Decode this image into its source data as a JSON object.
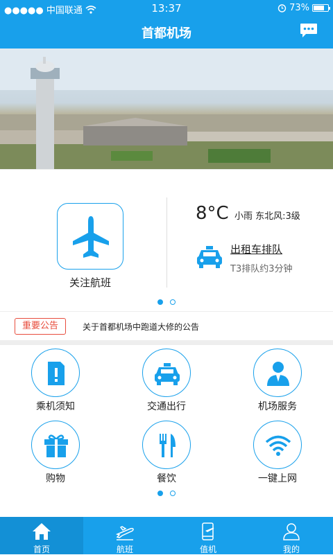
{
  "status_bar": {
    "carrier": "●●●●● 中国联通",
    "time": "13:37",
    "battery": "73%",
    "battery_level": 0.73
  },
  "nav": {
    "title": "首都机场",
    "message_icon": "message-icon"
  },
  "banner": {
    "page_count": 2,
    "active_page": 1
  },
  "quick": {
    "follow_label": "关注航班",
    "temperature": "8°C",
    "weather": "小雨  东北风:3级",
    "taxi_title": "出租车排队",
    "taxi_sub": "T3排队约3分钟",
    "page_count": 2,
    "active_page": 1
  },
  "notice": {
    "tag": "重要公告",
    "text": "关于首都机场中跑道大修的公告"
  },
  "services": [
    {
      "label": "乘机须知",
      "icon": "notice-document-icon"
    },
    {
      "label": "交通出行",
      "icon": "taxi-icon"
    },
    {
      "label": "机场服务",
      "icon": "staff-person-icon"
    },
    {
      "label": "购物",
      "icon": "gift-icon"
    },
    {
      "label": "餐饮",
      "icon": "fork-knife-icon"
    },
    {
      "label": "一键上网",
      "icon": "wifi-icon"
    }
  ],
  "tabs": [
    {
      "label": "首页",
      "icon": "home-icon",
      "active": true
    },
    {
      "label": "航班",
      "icon": "flight-icon",
      "active": false
    },
    {
      "label": "值机",
      "icon": "checkin-phone-icon",
      "active": false
    },
    {
      "label": "我的",
      "icon": "user-icon",
      "active": false
    }
  ],
  "colors": {
    "primary": "#18a0eb",
    "alert": "#e74c3c"
  }
}
